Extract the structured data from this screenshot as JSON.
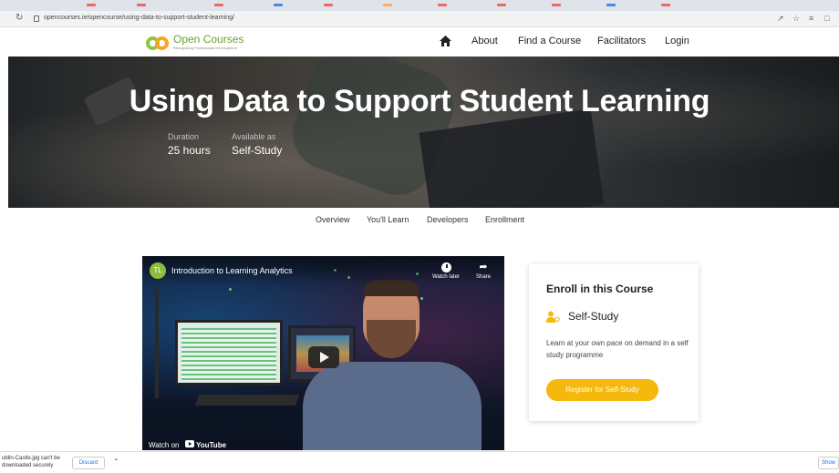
{
  "browser": {
    "url": "opencourses.ie/opencourse/using-data-to-support-student-learning/",
    "reload_icon": "reload-icon",
    "lock_icon": "lock-icon"
  },
  "site": {
    "logo_text": "Open Courses",
    "logo_tagline": "Recognising Professional Development",
    "nav": {
      "home_icon": "home-icon",
      "about": "About",
      "find": "Find a Course",
      "facilitators": "Facilitators",
      "login": "Login"
    }
  },
  "hero": {
    "title": "Using Data to Support Student Learning",
    "duration_label": "Duration",
    "duration_value": "25 hours",
    "available_label": "Available as",
    "available_value": "Self-Study"
  },
  "subnav": {
    "overview": "Overview",
    "learn": "You'll Learn",
    "developers": "Developers",
    "enrollment": "Enrollment"
  },
  "video": {
    "channel_initials": "TL",
    "title": "Introduction to Learning Analytics",
    "watch_later": "Watch later",
    "share": "Share",
    "watch_on": "Watch on",
    "youtube": "YouTube",
    "play_icon": "play-icon"
  },
  "enroll": {
    "title": "Enroll in this Course",
    "mode": "Self-Study",
    "mode_icon": "person-icon",
    "description": "Learn at your own pace on demand in a self study programme",
    "button": "Register for Self-Study",
    "button_color": "#f5b80d"
  },
  "downloads": {
    "file_text": "ublin-Castle.jpg can't be downloaded securely",
    "discard": "Discard",
    "show": "Show"
  }
}
